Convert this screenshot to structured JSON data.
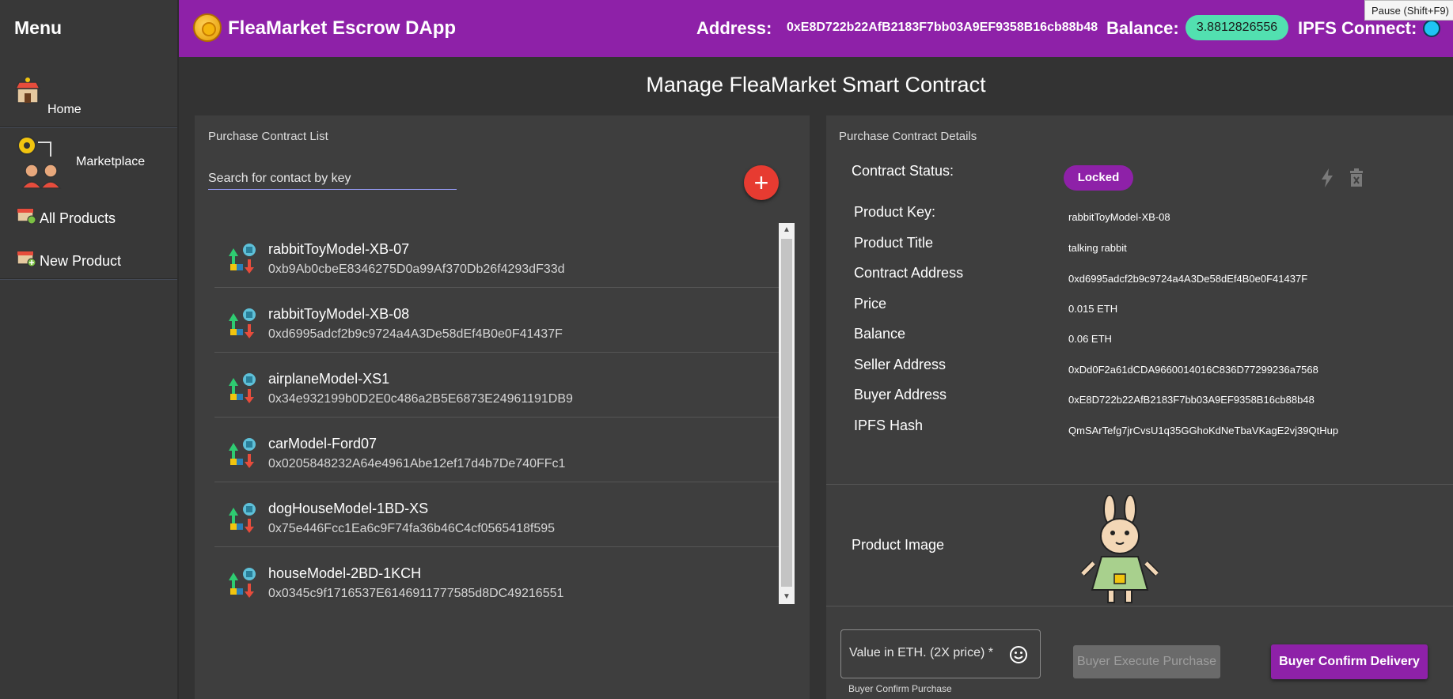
{
  "sidebar": {
    "title": "Menu",
    "items": [
      {
        "label": "Home",
        "icon": "store-icon"
      },
      {
        "label": "Marketplace",
        "icon": "gear-people-icon"
      },
      {
        "label": "All Products",
        "icon": "products-icon"
      },
      {
        "label": "New Product",
        "icon": "new-product-icon"
      }
    ]
  },
  "header": {
    "app_title": "FleaMarket Escrow DApp",
    "address_label": "Address:",
    "address_value": "0xE8D722b22AfB2183F7bb03A9EF9358B16cb88b48",
    "balance_label": "Balance:",
    "balance_value": "3.8812826556",
    "ipfs_label": "IPFS Connect:",
    "tooltip": "Pause (Shift+F9)",
    "colors": {
      "bar": "#8e21a8",
      "balance_badge": "#52e0b0",
      "ipfs_status": "#1ec4f4"
    }
  },
  "page_title": "Manage FleaMarket Smart Contract",
  "contract_list": {
    "title": "Purchase Contract List",
    "search_placeholder": "Search for contact by key",
    "items": [
      {
        "title": "rabbitToyModel-XB-07",
        "address": "0xb9Ab0cbeE8346275D0a99Af370Db26f4293dF33d"
      },
      {
        "title": "rabbitToyModel-XB-08",
        "address": "0xd6995adcf2b9c9724a4A3De58dEf4B0e0F41437F"
      },
      {
        "title": "airplaneModel-XS1",
        "address": "0x34e932199b0D2E0c486a2B5E6873E24961191DB9"
      },
      {
        "title": "carModel-Ford07",
        "address": "0x0205848232A64e4961Abe12ef17d4b7De740FFc1"
      },
      {
        "title": "dogHouseModel-1BD-XS",
        "address": "0x75e446Fcc1Ea6c9F74fa36b46C4cf0565418f595"
      },
      {
        "title": "houseModel-2BD-1KCH",
        "address": "0x0345c9f1716537E6146911777585d8DC49216551"
      }
    ]
  },
  "details": {
    "title": "Purchase Contract Details",
    "status_label": "Contract Status:",
    "status_value": "Locked",
    "fields": [
      {
        "label": "Product Key:",
        "value": "rabbitToyModel-XB-08"
      },
      {
        "label": "Product Title",
        "value": "talking rabbit"
      },
      {
        "label": "Contract Address",
        "value": "0xd6995adcf2b9c9724a4A3De58dEf4B0e0F41437F"
      },
      {
        "label": "Price",
        "value": "0.015 ETH"
      },
      {
        "label": "Balance",
        "value": "0.06 ETH"
      },
      {
        "label": "Seller Address",
        "value": "0xDd0F2a61dCDA9660014016C836D77299236a7568"
      },
      {
        "label": "Buyer Address",
        "value": "0xE8D722b22AfB2183F7bb03A9EF9358B16cb88b48"
      },
      {
        "label": "IPFS Hash",
        "value": "QmSArTefg7jrCvsU1q35GGhoKdNeTbaVKagE2vj39QtHup"
      }
    ],
    "image_label": "Product Image",
    "value_placeholder": "Value in ETH. (2X price) *",
    "helper_text": "Buyer Confirm Purchase",
    "execute_button": "Buyer Execute Purchase",
    "confirm_button": "Buyer Confirm Delivery"
  }
}
